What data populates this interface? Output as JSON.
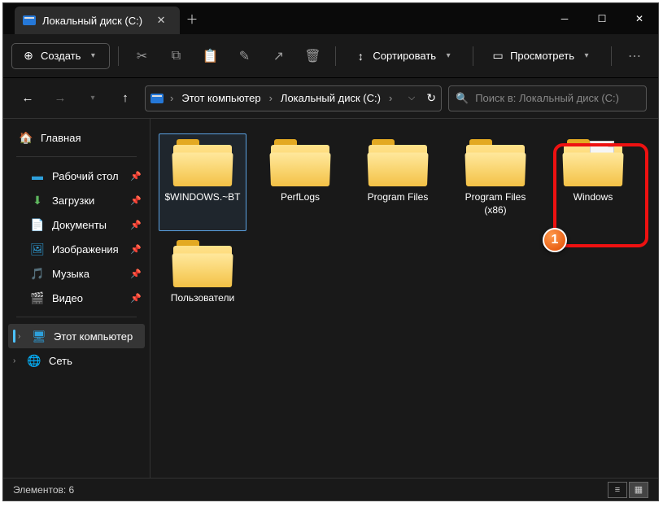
{
  "tab": {
    "title": "Локальный диск (C:)"
  },
  "toolbar": {
    "create": "Создать",
    "sort": "Сортировать",
    "view": "Просмотреть"
  },
  "breadcrumb": {
    "seg1": "Этот компьютер",
    "seg2": "Локальный диск (C:)"
  },
  "search": {
    "placeholder": "Поиск в: Локальный диск (C:)"
  },
  "sidebar": {
    "home": "Главная",
    "desktop": "Рабочий стол",
    "downloads": "Загрузки",
    "documents": "Документы",
    "pictures": "Изображения",
    "music": "Музыка",
    "videos": "Видео",
    "this_pc": "Этот компьютер",
    "network": "Сеть"
  },
  "folders": [
    {
      "name": "$WINDOWS.~BT",
      "selected": true,
      "has_doc": false
    },
    {
      "name": "PerfLogs",
      "selected": false,
      "has_doc": false
    },
    {
      "name": "Program Files",
      "selected": false,
      "has_doc": false
    },
    {
      "name": "Program Files (x86)",
      "selected": false,
      "has_doc": false
    },
    {
      "name": "Windows",
      "selected": false,
      "has_doc": true,
      "highlighted": true
    },
    {
      "name": "Пользователи",
      "selected": false,
      "has_doc": false
    }
  ],
  "callout": {
    "number": "1"
  },
  "status": {
    "text": "Элементов: 6"
  }
}
